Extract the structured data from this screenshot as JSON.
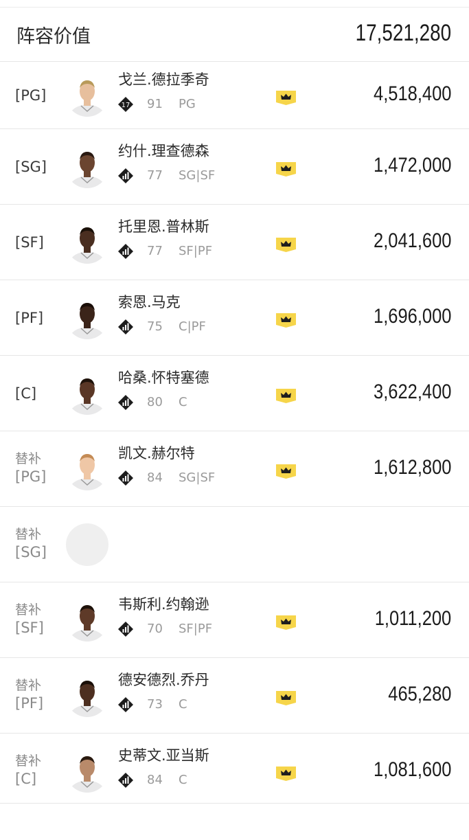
{
  "header": {
    "title": "阵容价值",
    "total": "17,521,280"
  },
  "bench_label": "替补",
  "rows": [
    {
      "slot": "[PG]",
      "bench": false,
      "name": "戈兰.德拉季奇",
      "rating": "91",
      "positions": "PG",
      "badge": "17",
      "price": "4,518,400",
      "skin": "#e7bf9d",
      "hair": "#b89a5a",
      "empty": false
    },
    {
      "slot": "[SG]",
      "bench": false,
      "name": "约什.理查德森",
      "rating": "77",
      "positions": "SG|SF",
      "badge": "",
      "price": "1,472,000",
      "skin": "#6b4530",
      "hair": "#2a1a12",
      "empty": false
    },
    {
      "slot": "[SF]",
      "bench": false,
      "name": "托里恩.普林斯",
      "rating": "77",
      "positions": "SF|PF",
      "badge": "",
      "price": "2,041,600",
      "skin": "#4a2e20",
      "hair": "#1a1008",
      "empty": false
    },
    {
      "slot": "[PF]",
      "bench": false,
      "name": "索恩.马克",
      "rating": "75",
      "positions": "C|PF",
      "badge": "",
      "price": "1,696,000",
      "skin": "#3b2419",
      "hair": "#1a0e08",
      "empty": false
    },
    {
      "slot": "[C]",
      "bench": false,
      "name": "哈桑.怀特塞德",
      "rating": "80",
      "positions": "C",
      "badge": "",
      "price": "3,622,400",
      "skin": "#5a3726",
      "hair": "#1e120a",
      "empty": false
    },
    {
      "slot": "[PG]",
      "bench": true,
      "name": "凯文.赫尔特",
      "rating": "84",
      "positions": "SG|SF",
      "badge": "",
      "price": "1,612,800",
      "skin": "#efc7a6",
      "hair": "#c48b55",
      "empty": false
    },
    {
      "slot": "[SG]",
      "bench": true,
      "name": "",
      "rating": "",
      "positions": "",
      "badge": "",
      "price": "",
      "skin": "",
      "hair": "",
      "empty": true
    },
    {
      "slot": "[SF]",
      "bench": true,
      "name": "韦斯利.约翰逊",
      "rating": "70",
      "positions": "SF|PF",
      "badge": "",
      "price": "1,011,200",
      "skin": "#5e3a28",
      "hair": "#1e120a",
      "empty": false
    },
    {
      "slot": "[PF]",
      "bench": true,
      "name": "德安德烈.乔丹",
      "rating": "73",
      "positions": "C",
      "badge": "",
      "price": "465,280",
      "skin": "#4d2f20",
      "hair": "#1a0f08",
      "empty": false
    },
    {
      "slot": "[C]",
      "bench": true,
      "name": "史蒂文.亚当斯",
      "rating": "84",
      "positions": "C",
      "badge": "",
      "price": "1,081,600",
      "skin": "#b98a6a",
      "hair": "#2a1a10",
      "empty": false
    }
  ],
  "colors": {
    "crown_bg": "#f6d54a",
    "crown_fg": "#1e1e1e",
    "badge_bg": "#1c1c1c"
  }
}
